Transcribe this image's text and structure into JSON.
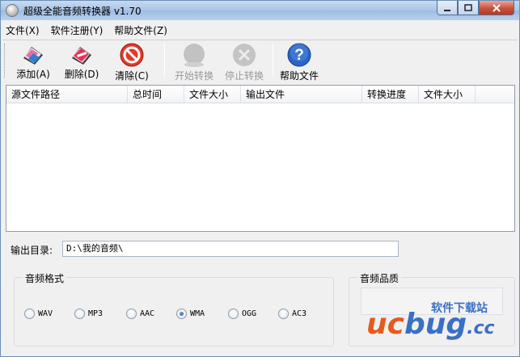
{
  "window": {
    "title": "超级全能音频转换器 v1.70"
  },
  "menu": [
    "文件(X)",
    "软件注册(Y)",
    "帮助文件(Z)"
  ],
  "toolbar": {
    "add": "添加(A)",
    "delete": "删除(D)",
    "clear": "清除(C)",
    "start": "开始转换",
    "stop": "停止转换",
    "help": "帮助文件"
  },
  "list": {
    "columns": [
      "源文件路径",
      "总时间",
      "文件大小",
      "输出文件",
      "转换进度",
      "文件大小"
    ]
  },
  "output": {
    "label": "输出目录:",
    "value": "D:\\我的音频\\"
  },
  "format_group": {
    "title": "音频格式",
    "options": [
      "WAV",
      "MP3",
      "AAC",
      "WMA",
      "OGG",
      "AC3"
    ],
    "selected": "WMA"
  },
  "quality_group": {
    "title": "音频品质"
  },
  "watermark": {
    "site": "软件下载站",
    "logo_u": "uc",
    "logo_b": "bug",
    "logo_cc": ".cc"
  },
  "colors": {
    "accent": "#3b6fc4",
    "logo_orange": "#e65a1e",
    "close_red": "#c8513b"
  }
}
